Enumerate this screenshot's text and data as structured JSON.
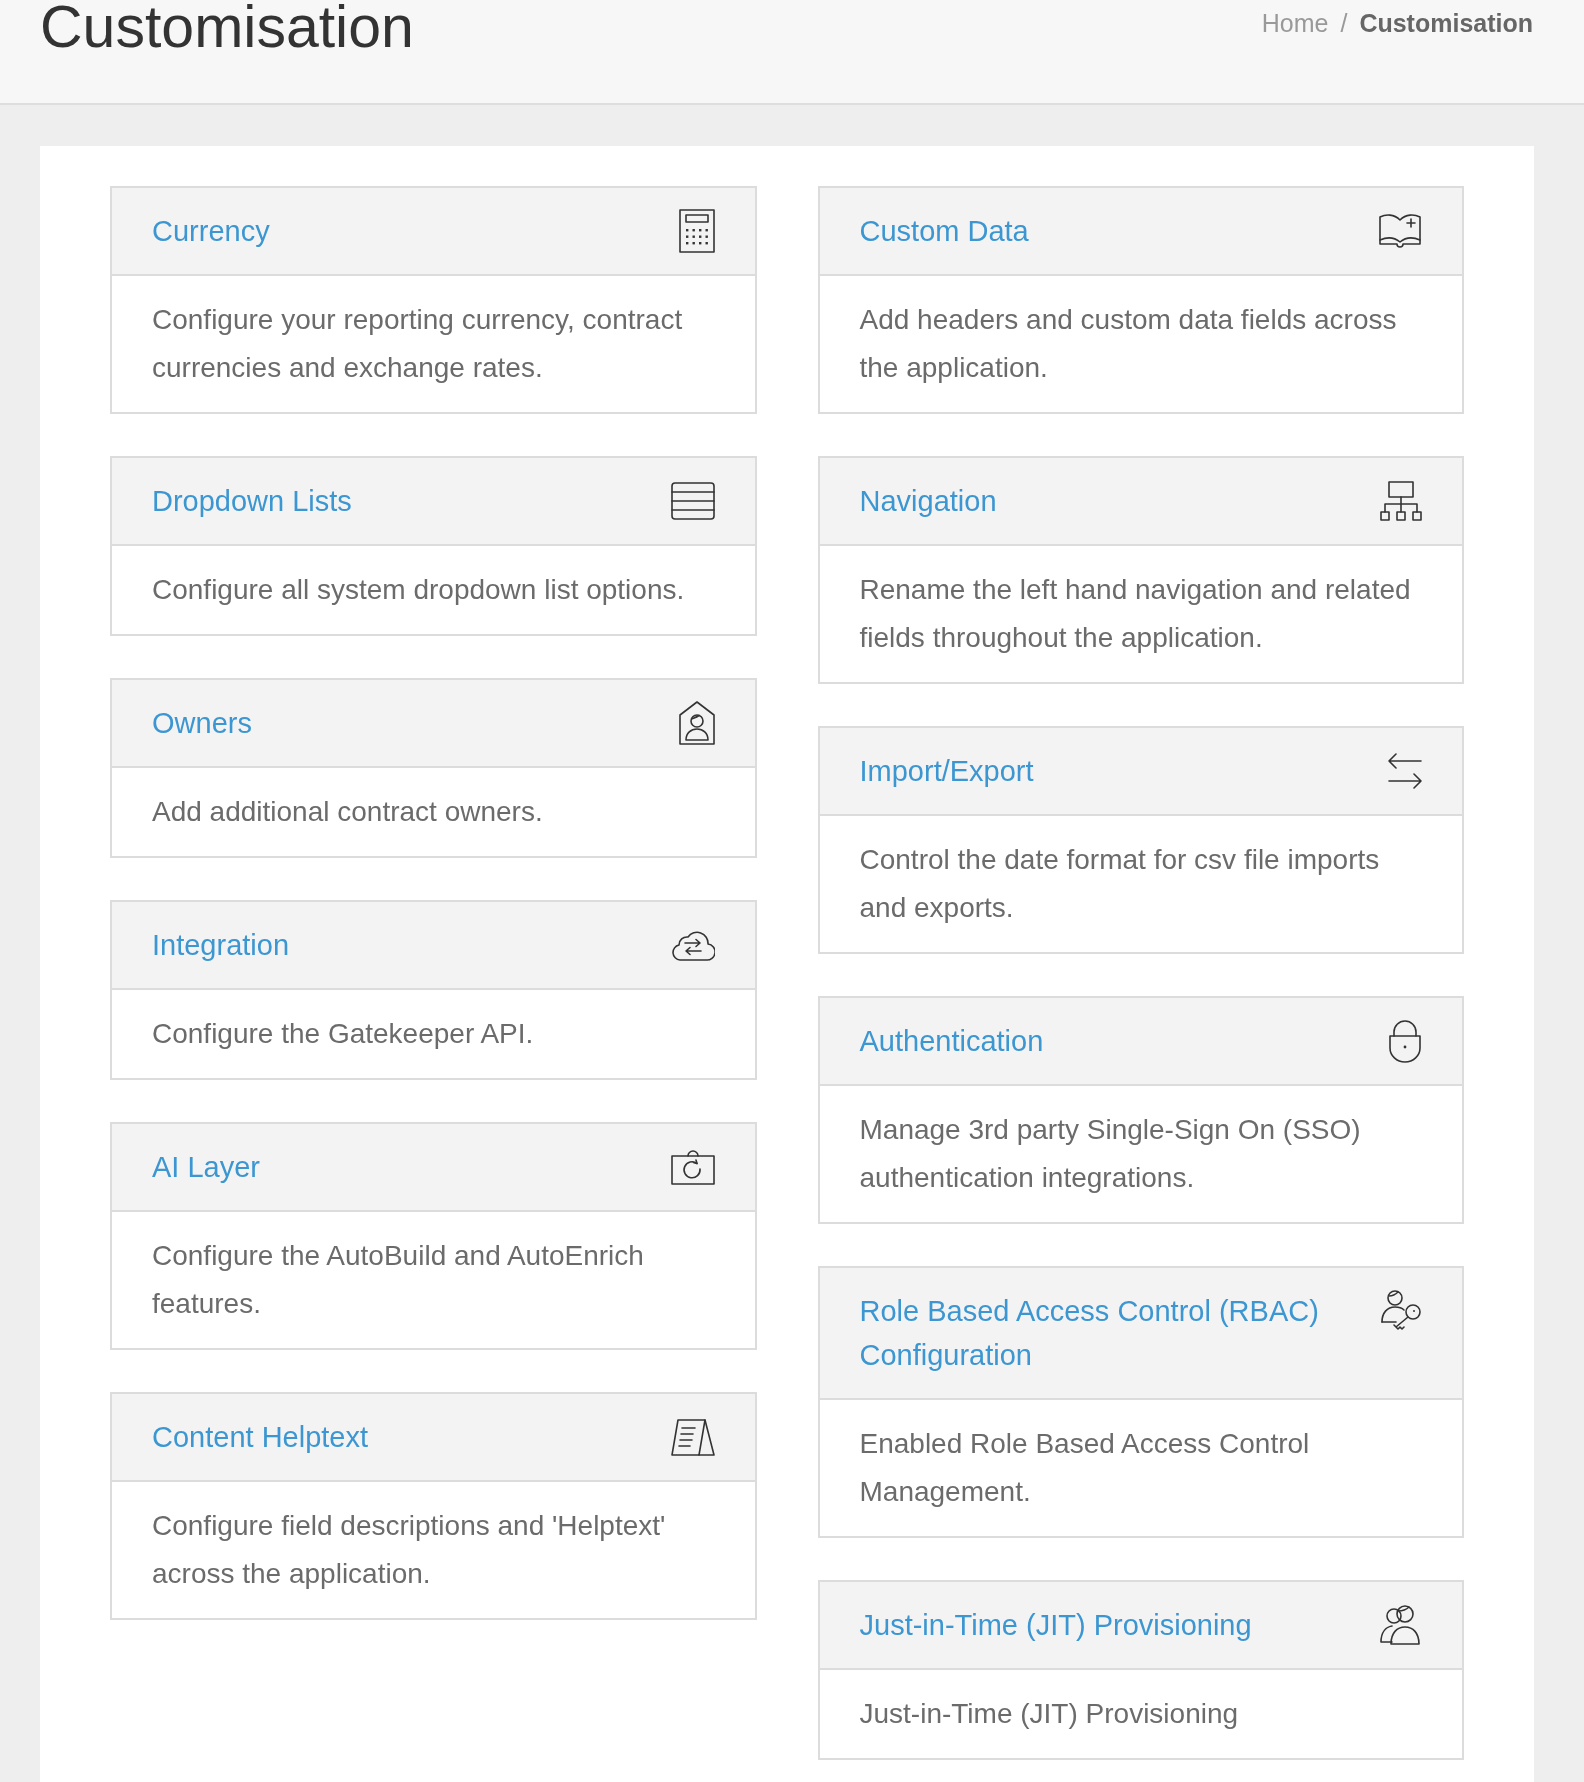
{
  "page_header": {
    "title": "Customisation",
    "breadcrumb": {
      "separator": "/",
      "items": [
        {
          "label": "Home",
          "current": false
        },
        {
          "label": "Customisation",
          "current": true
        }
      ]
    }
  },
  "left_column": [
    {
      "title": "Currency",
      "description": "Configure your reporting currency, contract currencies and exchange rates."
    },
    {
      "title": "Dropdown Lists",
      "description": "Configure all system dropdown list options."
    },
    {
      "title": "Owners",
      "description": "Add additional contract owners."
    },
    {
      "title": "Integration",
      "description": "Configure the Gatekeeper API."
    },
    {
      "title": "AI Layer",
      "description": "Configure the AutoBuild and AutoEnrich features."
    },
    {
      "title": "Content Helptext",
      "description": "Configure field descriptions and 'Helptext' across the application."
    }
  ],
  "right_column": [
    {
      "title": "Custom Data",
      "description": "Add headers and custom data fields across the application."
    },
    {
      "title": "Navigation",
      "description": "Rename the left hand navigation and related fields throughout the application."
    },
    {
      "title": "Import/Export",
      "description": "Control the date format for csv file imports and exports."
    },
    {
      "title": "Authentication",
      "description": "Manage 3rd party Single-Sign On (SSO) authentication integrations."
    },
    {
      "title": "Role Based Access Control (RBAC) Configuration",
      "description": "Enabled Role Based Access Control Management."
    },
    {
      "title": "Just-in-Time (JIT) Provisioning",
      "description": "Just-in-Time (JIT) Provisioning"
    }
  ]
}
